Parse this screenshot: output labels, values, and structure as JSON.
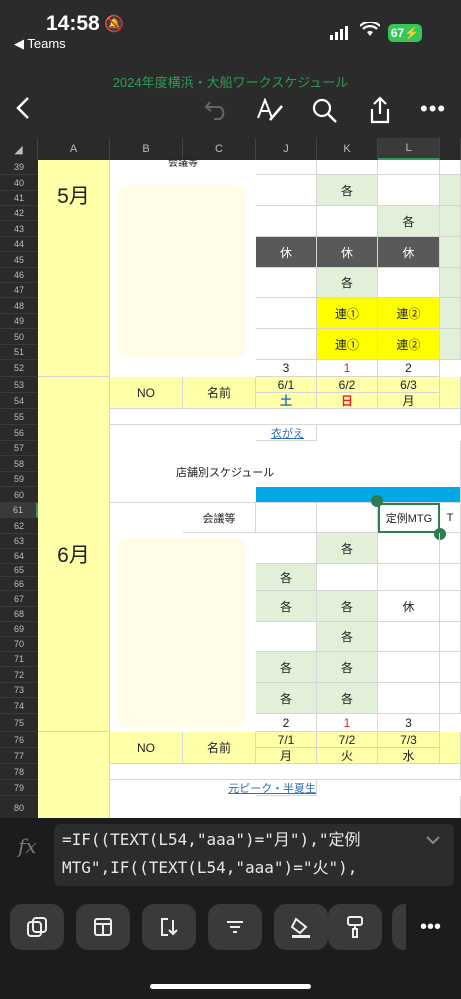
{
  "status": {
    "time": "14:58",
    "back_app": "◀ Teams",
    "battery": "67"
  },
  "document": {
    "title": "2024年度横浜・大船ワークスケジュール"
  },
  "columns": [
    "A",
    "B",
    "C",
    "J",
    "K",
    "L"
  ],
  "rows": [
    "39",
    "40",
    "41",
    "42",
    "43",
    "44",
    "45",
    "46",
    "47",
    "48",
    "49",
    "50",
    "51",
    "52",
    "53",
    "54",
    "55",
    "56",
    "57",
    "58",
    "59",
    "60",
    "61",
    "62",
    "63",
    "64",
    "65",
    "66",
    "67",
    "68",
    "69",
    "70",
    "71",
    "72",
    "73",
    "74",
    "75",
    "76",
    "77",
    "78",
    "79",
    "80"
  ],
  "months": {
    "may": "5月",
    "june": "6月"
  },
  "labels": {
    "meetings_top": "会議等",
    "meetings": "会議等",
    "no": "NO",
    "name": "名前",
    "store_schedule": "店舗別スケジュール",
    "koromogae": "衣がえ",
    "peak": "元ピーク・半夏生",
    "regular_mtg": "定例MTG",
    "t_cut": "T"
  },
  "may_grid": {
    "kaku": "各",
    "yasumi": "休",
    "ren1": "連①",
    "ren2": "連②"
  },
  "june_header": {
    "nums": [
      "3",
      "1",
      "2"
    ],
    "dates": [
      "6/1",
      "6/2",
      "6/3"
    ],
    "days": [
      "土",
      "日",
      "月"
    ]
  },
  "july_header": {
    "nums": [
      "2",
      "1",
      "3"
    ],
    "dates": [
      "7/1",
      "7/2",
      "7/3"
    ],
    "days": [
      "月",
      "火",
      "水"
    ]
  },
  "formula": {
    "fx": "fx",
    "line1": "=IF((TEXT(L54,\"aaa\")=\"月\"),\"定例",
    "line2": "MTG\",IF((TEXT(L54,\"aaa\")=\"火\"),"
  },
  "colors": {
    "highlight_yellow": "#ffff00",
    "month_yellow": "#ffffa8",
    "green_cell": "#e2efd9",
    "gray_cell": "#595959",
    "blue_bar": "#00a8e8",
    "accent_green": "#2e9b56"
  }
}
